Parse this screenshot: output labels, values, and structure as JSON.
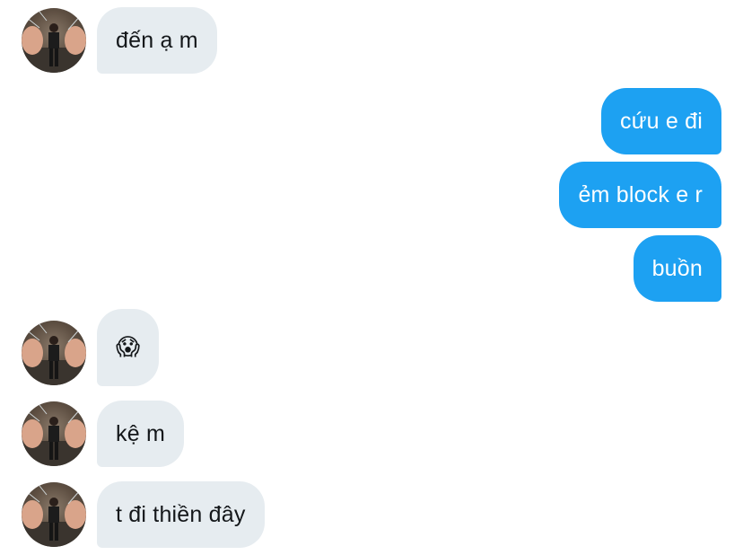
{
  "conversation": {
    "messages": [
      {
        "direction": "incoming",
        "text": "đến ạ m"
      },
      {
        "direction": "outgoing",
        "text": "cứu e đi"
      },
      {
        "direction": "outgoing",
        "text": "ẻm block e r"
      },
      {
        "direction": "outgoing",
        "text": "buồn"
      },
      {
        "direction": "incoming",
        "text": "😱"
      },
      {
        "direction": "incoming",
        "text": "kệ m"
      },
      {
        "direction": "incoming",
        "text": "t đi thiền đây"
      }
    ]
  },
  "colors": {
    "incoming_bubble": "#e6ecf0",
    "outgoing_bubble": "#1da1f2",
    "incoming_text": "#14171a",
    "outgoing_text": "#ffffff"
  },
  "icons": {
    "avatar": "user-avatar-photo"
  }
}
